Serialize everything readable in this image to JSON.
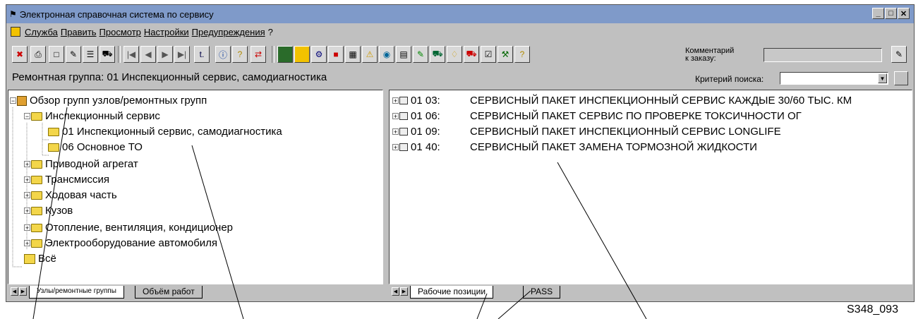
{
  "window": {
    "title": "Электронная справочная система по сервису",
    "buttons": [
      "_",
      "□",
      "✕"
    ]
  },
  "menu": [
    "Служба",
    "Править",
    "Просмотр",
    "Настройки",
    "Предупреждения",
    "?"
  ],
  "toolbar": {
    "comment_label_line1": "Комментарий",
    "comment_label_line2": "к заказу:"
  },
  "status": {
    "group_label": "Ремонтная группа: 01 Инспекционный сервис, самодиагностика",
    "search_label": "Критерий поиска:",
    "search_value": ""
  },
  "tree": [
    {
      "label": "Обзор групп узлов/ремонтных групп"
    },
    {
      "label": "Инспекционный сервис"
    },
    {
      "label": "01 Инспекционный сервис, самодиагностика"
    },
    {
      "label": "06 Основное ТО"
    },
    {
      "label": "Приводной агрегат"
    },
    {
      "label": "Трансмиссия"
    },
    {
      "label": "Ходовая часть"
    },
    {
      "label": "Кузов"
    },
    {
      "label": "Отопление, вентиляция, кондиционер"
    },
    {
      "label": "Электрооборудование автомобиля"
    },
    {
      "label": "Всё"
    }
  ],
  "packages": [
    {
      "code": "01 03:",
      "name": "СЕРВИСНЫЙ ПАКЕТ ИНСПЕКЦИОННЫЙ СЕРВИС КАЖДЫЕ 30/60 ТЫС. КМ"
    },
    {
      "code": "01 06:",
      "name": "СЕРВИСНЫЙ ПАКЕТ СЕРВИС ПО ПРОВЕРКЕ ТОКСИЧНОСТИ ОГ"
    },
    {
      "code": "01 09:",
      "name": "СЕРВИСНЫЙ ПАКЕТ ИНСПЕКЦИОННЫЙ СЕРВИС LONGLIFE"
    },
    {
      "code": "01 40:",
      "name": "СЕРВИСНЫЙ ПАКЕТ ЗАМЕНА ТОРМОЗНОЙ ЖИДКОСТИ"
    }
  ],
  "left_tabs": [
    "Узлы/ремонтные группы",
    "Объём работ"
  ],
  "right_tabs": [
    "Рабочие позиции",
    "PASS"
  ],
  "figure_id": "S348_093"
}
